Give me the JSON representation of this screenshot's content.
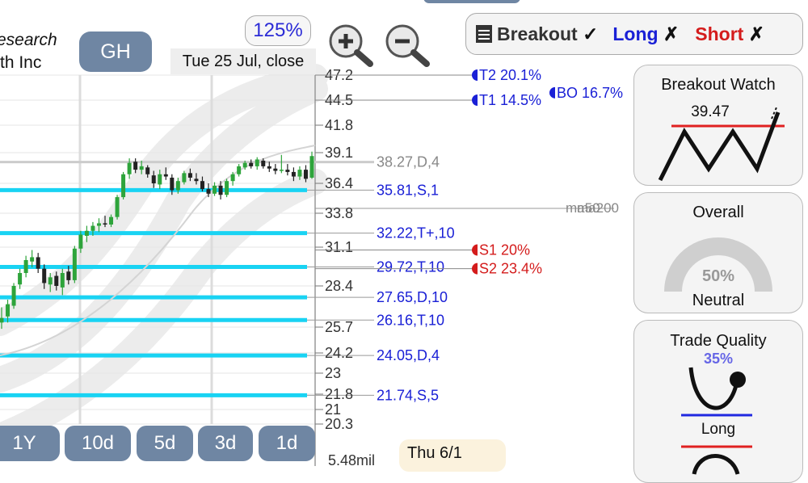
{
  "header": {
    "name_line1": "esearch",
    "name_line2": "th Inc",
    "ticker": "GH",
    "zoom": "125%",
    "date_label": "Tue 25 Jul, close",
    "bottom_date": "Thu 6/1",
    "volume": "5.48mil"
  },
  "mode_bar": {
    "breakout": "Breakout",
    "breakout_mark": "✓",
    "long": "Long",
    "long_mark": "✗",
    "short": "Short",
    "short_mark": "✗"
  },
  "ranges": [
    "1Y",
    "10d",
    "5d",
    "3d",
    "1d"
  ],
  "panels": {
    "breakout_watch": {
      "title": "Breakout Watch",
      "value": "39.47"
    },
    "overall": {
      "title": "Overall",
      "percent": "50%",
      "percent_value": 50,
      "status": "Neutral"
    },
    "trade_quality": {
      "title": "Trade Quality",
      "percent": "35%",
      "label_long": "Long"
    }
  },
  "colors": {
    "level_line": "#19d3f3",
    "up_candle": "#2ea43b",
    "down_candle": "#222222",
    "target": "#1a20d6",
    "stop": "#d41c1c",
    "accent_pill": "#6f86a3"
  },
  "chart_data": {
    "type": "candlestick",
    "y_ticks": [
      "47.2",
      "44.5",
      "41.8",
      "39.1",
      "36.4",
      "33.8",
      "31.1",
      "28.4",
      "25.7",
      "24.2",
      "23",
      "21.8",
      "21",
      "20.3"
    ],
    "ylim": [
      20.3,
      47.2
    ],
    "levels": [
      {
        "label": "38.27,D,4",
        "value": 38.27,
        "style": "gray"
      },
      {
        "label": "35.81,S,1",
        "value": 35.81,
        "style": "cyan"
      },
      {
        "label": "32.22,T+,10",
        "value": 32.22,
        "style": "cyan"
      },
      {
        "label": "29.72,T,10",
        "value": 29.72,
        "style": "cyan"
      },
      {
        "label": "27.65,D,10",
        "value": 27.65,
        "style": "cyan"
      },
      {
        "label": "26.16,T,10",
        "value": 26.16,
        "style": "cyan"
      },
      {
        "label": "24.05,D,4",
        "value": 24.05,
        "style": "cyan"
      },
      {
        "label": "21.74,S,5",
        "value": 21.74,
        "style": "cyan"
      }
    ],
    "targets": [
      {
        "label": "T2 20.1%",
        "value": 47.2,
        "kind": "target"
      },
      {
        "label": "T1 14.5%",
        "value": 44.5,
        "kind": "target"
      },
      {
        "label": "BO 16.7%",
        "value": 45.3,
        "kind": "target"
      },
      {
        "label": "S1 20%",
        "value": 30.9,
        "kind": "stop"
      },
      {
        "label": "S2 23.4%",
        "value": 29.6,
        "kind": "stop"
      }
    ],
    "ma_labels": [
      {
        "label": "ma50",
        "value": 33.8
      },
      {
        "label": "ma200",
        "value": 33.8
      }
    ],
    "candles": [
      [
        26.0,
        27.0,
        25.6,
        26.3
      ],
      [
        26.4,
        27.5,
        26.0,
        27.2
      ],
      [
        27.1,
        28.6,
        26.9,
        28.4
      ],
      [
        28.5,
        29.6,
        28.2,
        29.3
      ],
      [
        29.3,
        30.5,
        29.0,
        30.2
      ],
      [
        30.1,
        30.9,
        29.7,
        30.4
      ],
      [
        30.4,
        30.7,
        29.3,
        29.6
      ],
      [
        29.6,
        29.9,
        28.2,
        28.6
      ],
      [
        28.5,
        29.3,
        28.0,
        29.0
      ],
      [
        29.1,
        29.4,
        28.1,
        28.4
      ],
      [
        28.3,
        29.6,
        27.8,
        29.3
      ],
      [
        29.4,
        29.8,
        28.5,
        28.8
      ],
      [
        28.8,
        31.2,
        28.6,
        31.0
      ],
      [
        31.0,
        32.4,
        30.7,
        32.1
      ],
      [
        32.0,
        32.8,
        31.5,
        32.4
      ],
      [
        32.4,
        33.1,
        32.0,
        32.8
      ],
      [
        32.8,
        33.4,
        32.3,
        33.0
      ],
      [
        33.0,
        33.6,
        32.7,
        32.9
      ],
      [
        32.9,
        33.7,
        32.7,
        33.5
      ],
      [
        33.5,
        35.4,
        33.3,
        35.2
      ],
      [
        35.2,
        37.4,
        35.0,
        37.2
      ],
      [
        37.2,
        38.6,
        36.8,
        38.2
      ],
      [
        38.3,
        38.6,
        37.3,
        37.6
      ],
      [
        37.6,
        38.4,
        37.2,
        37.9
      ],
      [
        37.8,
        38.0,
        36.9,
        37.2
      ],
      [
        37.1,
        37.5,
        36.0,
        36.4
      ],
      [
        36.3,
        37.6,
        35.9,
        37.2
      ],
      [
        37.2,
        37.8,
        36.7,
        37.0
      ],
      [
        36.9,
        37.2,
        35.4,
        35.8
      ],
      [
        35.8,
        36.9,
        35.5,
        36.6
      ],
      [
        36.5,
        37.5,
        36.3,
        37.3
      ],
      [
        37.3,
        37.7,
        36.6,
        36.9
      ],
      [
        36.8,
        37.3,
        36.3,
        36.6
      ],
      [
        36.6,
        37.0,
        35.7,
        35.9
      ],
      [
        35.9,
        36.4,
        35.2,
        35.5
      ],
      [
        35.5,
        36.5,
        35.3,
        36.2
      ],
      [
        36.2,
        36.6,
        35.0,
        35.4
      ],
      [
        35.4,
        36.8,
        35.2,
        36.6
      ],
      [
        36.6,
        37.4,
        36.2,
        37.2
      ],
      [
        37.2,
        38.1,
        37.0,
        37.9
      ],
      [
        37.8,
        38.4,
        37.6,
        38.2
      ],
      [
        38.2,
        38.5,
        37.7,
        37.9
      ],
      [
        37.9,
        38.7,
        37.6,
        38.5
      ],
      [
        38.4,
        38.6,
        37.7,
        37.9
      ],
      [
        37.9,
        38.3,
        37.4,
        37.7
      ],
      [
        37.7,
        38.1,
        37.2,
        37.5
      ],
      [
        37.5,
        38.9,
        37.3,
        37.6
      ],
      [
        37.6,
        38.1,
        37.1,
        37.4
      ],
      [
        37.4,
        37.8,
        36.6,
        37.0
      ],
      [
        37.0,
        37.9,
        36.7,
        37.6
      ],
      [
        37.6,
        38.0,
        36.5,
        36.8
      ],
      [
        36.9,
        39.2,
        36.8,
        38.8
      ]
    ]
  }
}
